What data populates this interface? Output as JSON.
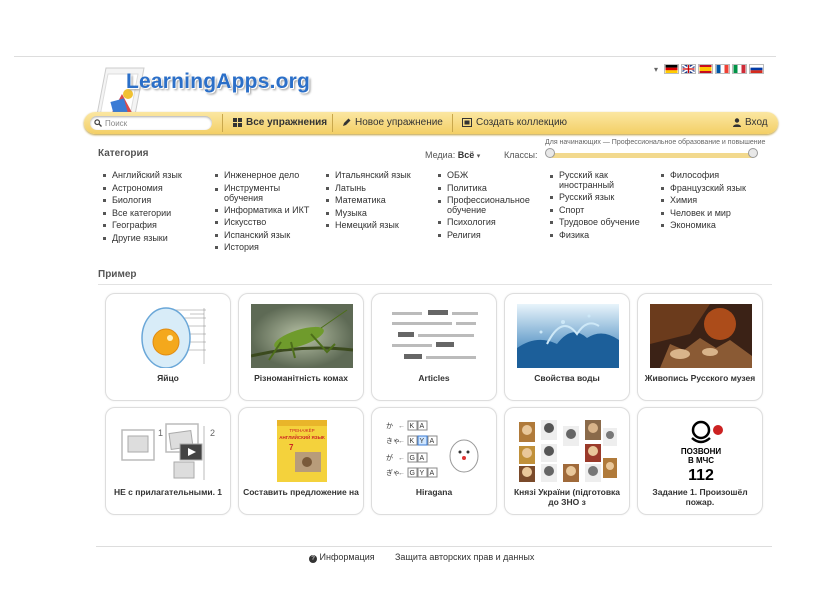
{
  "logo": {
    "text": "LearningApps.org"
  },
  "language": {
    "dropdown": "▾",
    "flags": [
      "de",
      "gb",
      "es",
      "fr",
      "it",
      "ru"
    ]
  },
  "nav": {
    "search_placeholder": "Поиск",
    "all_exercises": "Все упражнения",
    "new_exercise": "Новое упражнение",
    "create_collection": "Создать коллекцию",
    "login": "Вход"
  },
  "filters": {
    "category_title": "Категория",
    "media_label": "Медиа:",
    "media_value": "Всё",
    "classes_label": "Классы:",
    "range_caption": "Для начинающих — Профессиональное образование и повышение"
  },
  "categories": [
    [
      "Английский язык",
      "Астрономия",
      "Биология",
      "Все категории",
      "География",
      "Другие языки"
    ],
    [
      "Инженерное дело",
      "Инструменты обучения",
      "Информатика и ИКТ",
      "Искусство",
      "Испанский язык",
      "История"
    ],
    [
      "Итальянский язык",
      "Латынь",
      "Математика",
      "Музыка",
      "Немецкий язык"
    ],
    [
      "ОБЖ",
      "Политика",
      "Профессиональное обучение",
      "Психология",
      "Религия"
    ],
    [
      "Русский как иностранный",
      "Русский язык",
      "Спорт",
      "Трудовое обучение",
      "Физика"
    ],
    [
      "Философия",
      "Французский язык",
      "Химия",
      "Человек и мир",
      "Экономика"
    ]
  ],
  "samples": {
    "title": "Пример",
    "cards": [
      {
        "caption": "Яйцо",
        "icon": "egg-diagram"
      },
      {
        "caption": "Різноманітність комах",
        "icon": "grasshopper-photo"
      },
      {
        "caption": "Articles",
        "icon": "text-lines"
      },
      {
        "caption": "Свойства воды",
        "icon": "water-splash-photo"
      },
      {
        "caption": "Живопись Русского музея",
        "icon": "painting"
      },
      {
        "caption": "НЕ с прилагательными. 1",
        "icon": "pair-matching"
      },
      {
        "caption": "Составить предложение на",
        "icon": "book-cover"
      },
      {
        "caption": "Hiragana",
        "icon": "hiragana-matching"
      },
      {
        "caption": "Князі України (підготовка до ЗНО з",
        "icon": "portraits-grid"
      },
      {
        "caption": "Задание 1. Произошёл пожар.",
        "icon": "mchs-poster"
      }
    ],
    "book_text": {
      "line1": "ТРЕНАЖЁР",
      "line2": "АНГЛИЙСКИЙ ЯЗЫК",
      "grade": "7"
    },
    "hiragana_rows": [
      {
        "kana": "か",
        "a": "K",
        "b": "A"
      },
      {
        "kana": "きゃ",
        "a": "K",
        "b": "Y",
        "c": "A"
      },
      {
        "kana": "が",
        "a": "G",
        "b": "A"
      },
      {
        "kana": "ぎゃ",
        "a": "G",
        "b": "Y",
        "c": "A"
      }
    ],
    "mchs": {
      "line1": "ПОЗВОНИ",
      "line2": "В МЧС",
      "number": "112"
    },
    "pair_numbers": [
      "1",
      "2"
    ]
  },
  "footer": {
    "info": "Информация",
    "copyright": "Защита авторских прав и данных"
  }
}
